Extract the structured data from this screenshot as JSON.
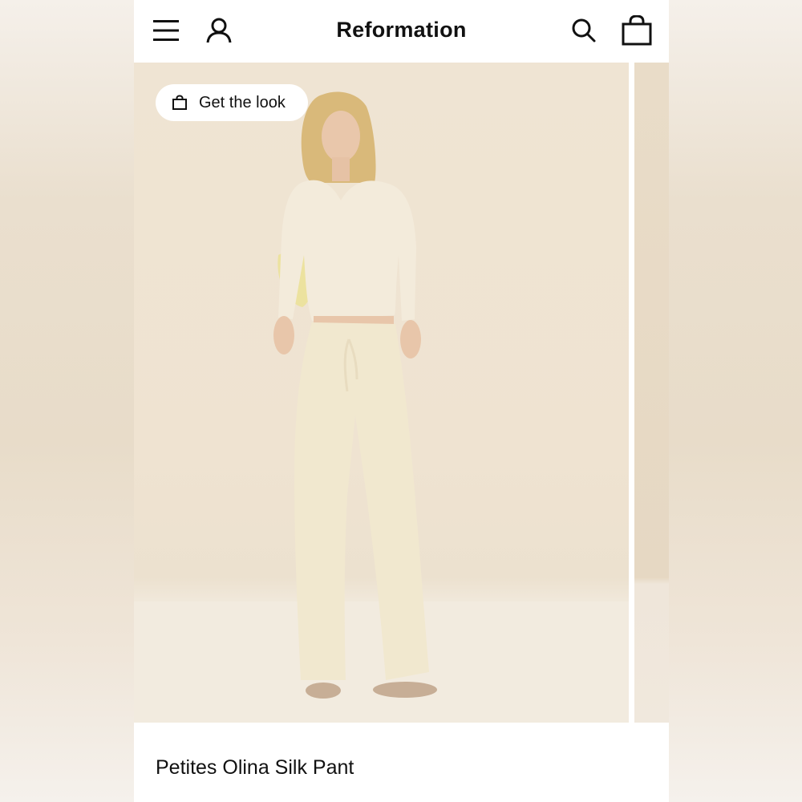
{
  "header": {
    "brand": "Reformation",
    "icons": {
      "menu": "hamburger-menu-icon",
      "account": "user-icon",
      "search": "search-icon",
      "bag": "shopping-bag-icon"
    }
  },
  "carousel": {
    "get_the_look_label": "Get the look"
  },
  "product": {
    "name": "Petites Olina Silk Pant"
  },
  "colors": {
    "header_bg": "#ffffff",
    "text": "#111111",
    "backdrop": "#efe4d3"
  }
}
